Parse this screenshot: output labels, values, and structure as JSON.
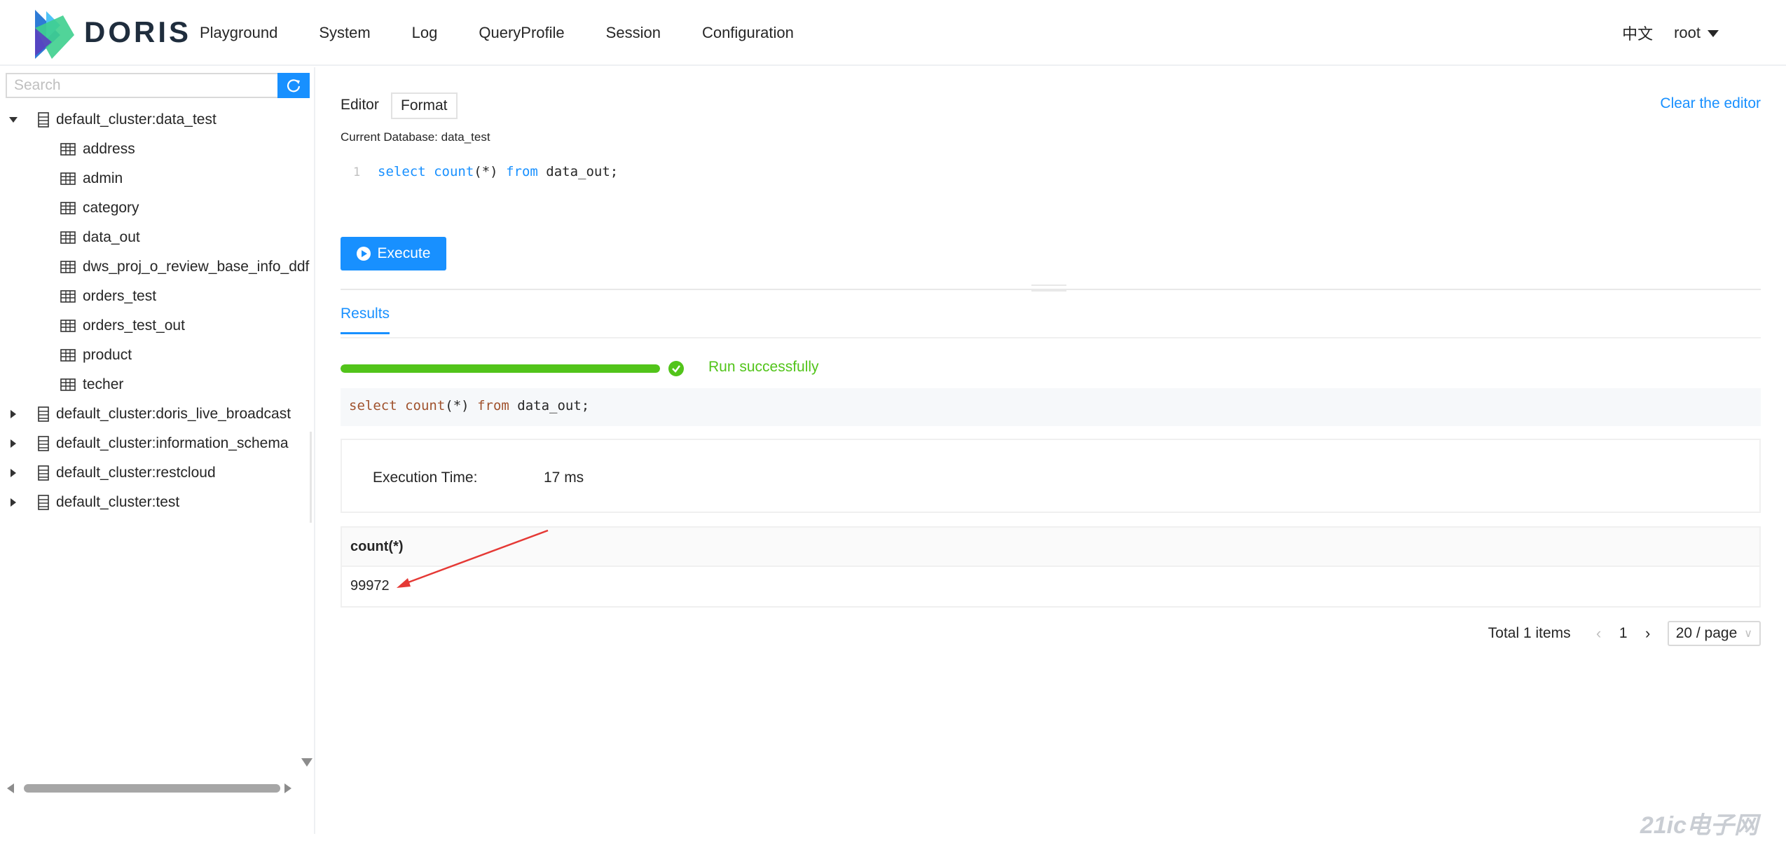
{
  "brand": {
    "name": "DORIS"
  },
  "nav": [
    {
      "label": "Playground"
    },
    {
      "label": "System"
    },
    {
      "label": "Log"
    },
    {
      "label": "QueryProfile"
    },
    {
      "label": "Session"
    },
    {
      "label": "Configuration"
    }
  ],
  "header": {
    "language": "中文",
    "user": "root"
  },
  "sidebar": {
    "search_placeholder": "Search",
    "tree": [
      {
        "label": "default_cluster:data_test",
        "type": "database",
        "expanded": true
      },
      {
        "label": "address",
        "type": "table"
      },
      {
        "label": "admin",
        "type": "table"
      },
      {
        "label": "category",
        "type": "table"
      },
      {
        "label": "data_out",
        "type": "table"
      },
      {
        "label": "dws_proj_o_review_base_info_ddf",
        "type": "table"
      },
      {
        "label": "orders_test",
        "type": "table"
      },
      {
        "label": "orders_test_out",
        "type": "table"
      },
      {
        "label": "product",
        "type": "table"
      },
      {
        "label": "techer",
        "type": "table"
      },
      {
        "label": "default_cluster:doris_live_broadcast",
        "type": "database",
        "expanded": false
      },
      {
        "label": "default_cluster:information_schema",
        "type": "database",
        "expanded": false
      },
      {
        "label": "default_cluster:restcloud",
        "type": "database",
        "expanded": false
      },
      {
        "label": "default_cluster:test",
        "type": "database",
        "expanded": false
      }
    ]
  },
  "editor": {
    "label": "Editor",
    "format_label": "Format",
    "clear_label": "Clear the editor",
    "current_db": "Current Database: data_test",
    "line_number": "1",
    "code": {
      "kw1": "select",
      "fn": "count",
      "args": "(*) ",
      "kw2": "from",
      "rest": " data_out;"
    },
    "execute_label": "Execute"
  },
  "results": {
    "tab_label": "Results",
    "progress": 1.0,
    "status": "Run successfully",
    "sql": {
      "kw1": "select",
      "fn": "count",
      "args": "(*) ",
      "kw2": "from",
      "rest": " data_out;"
    },
    "exec_time_label": "Execution Time:",
    "exec_time_value": "17 ms",
    "columns": [
      "count(*)"
    ],
    "rows": [
      [
        "99972"
      ]
    ]
  },
  "pagination": {
    "total": "Total 1 items",
    "page": "1",
    "page_size": "20 / page"
  },
  "colors": {
    "accent": "#1890ff",
    "success": "#52c41a",
    "annotation": "#e53935"
  },
  "watermark": "21ic电子网"
}
